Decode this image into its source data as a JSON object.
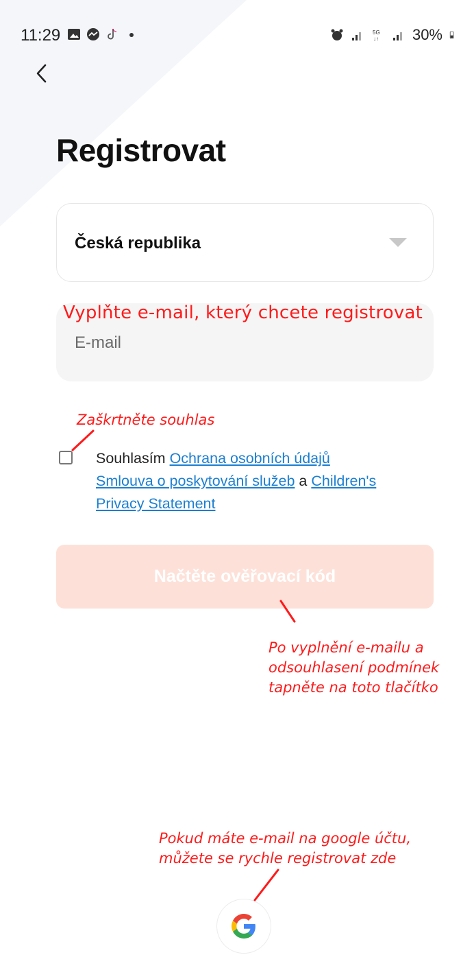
{
  "status_bar": {
    "time": "11:29",
    "battery": "30%",
    "icons_left": [
      "gallery-icon",
      "messenger-icon",
      "tiktok-icon",
      "dot-icon"
    ],
    "icons_right": [
      "alarm-icon",
      "signal-icon",
      "5g-icon",
      "signal-icon",
      "battery-icon"
    ]
  },
  "header": {
    "back_icon": "chevron-left-icon"
  },
  "page": {
    "title": "Registrovat"
  },
  "country": {
    "value": "Česká republika",
    "icon": "caret-down-icon"
  },
  "email": {
    "placeholder": "E-mail",
    "value": ""
  },
  "consent": {
    "checked": false,
    "prefix": "Souhlasím",
    "link_privacy": "Ochrana osobních údajů",
    "link_terms": "Smlouva o poskytování služeb",
    "conjunction": "a",
    "link_children": "Children's Privacy Statement"
  },
  "submit": {
    "label": "Načtěte ověřovací kód"
  },
  "annotations": {
    "email_hint": "Vyplňte e-mail, který chcete registrovat",
    "checkbox_hint": "Zaškrtněte souhlas",
    "button_hint_1": "Po vyplnění e-mailu a",
    "button_hint_2": "odsouhlasení podmínek",
    "button_hint_3": "tapněte na toto tlačítko",
    "google_hint_1": "Pokud máte e-mail na google účtu,",
    "google_hint_2": "můžete se rychle registrovat zde"
  },
  "colors": {
    "annotation": "#ff1a1a",
    "link": "#1b7fd1",
    "button_disabled": "#fde1d8",
    "field_bg": "#f5f5f5"
  }
}
